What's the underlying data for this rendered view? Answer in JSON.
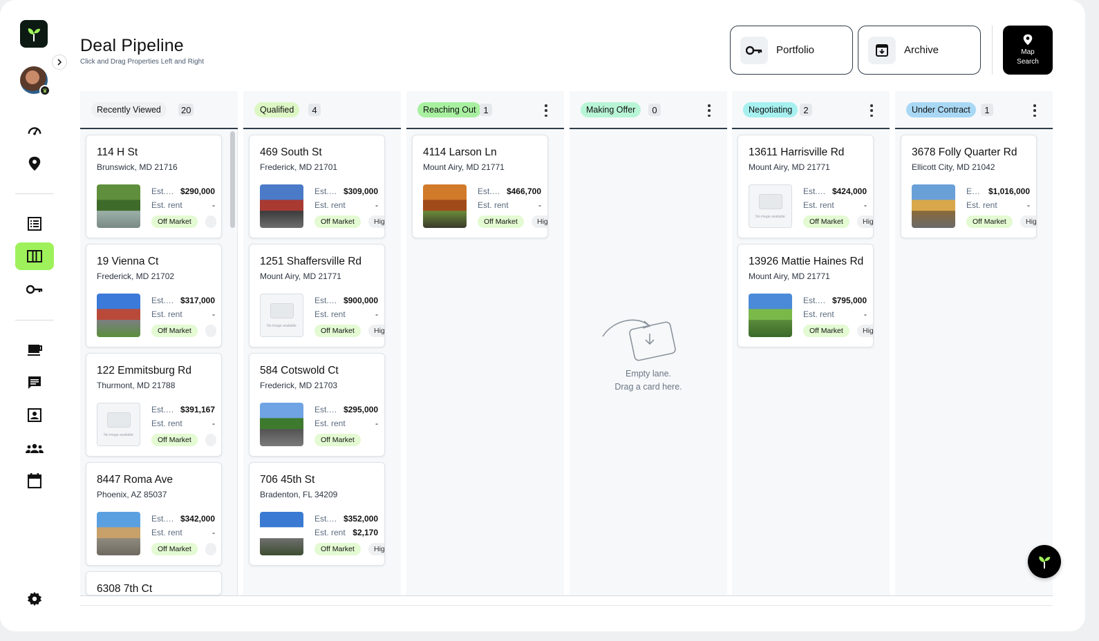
{
  "header": {
    "title": "Deal Pipeline",
    "subtitle": "Click and Drag Properties Left and Right",
    "portfolio_label": "Portfolio",
    "archive_label": "Archive",
    "map_search_label": "Map Search"
  },
  "sidebar": {
    "items": [
      "dashboard-icon",
      "location-icon",
      "list-icon",
      "kanban-icon",
      "key-icon",
      "inbox-icon",
      "chat-icon",
      "contact-icon",
      "team-icon",
      "calendar-icon",
      "settings-icon"
    ],
    "active": "kanban-icon"
  },
  "colors": {
    "accent": "#9ef15a",
    "recently_viewed": "#eef0f2",
    "qualified": "#ddf7c4",
    "reaching_out": "#a8f0a0",
    "making_offer": "#b8f5d6",
    "negotiating": "#a6f0f0",
    "under_contract": "#a9d8f5"
  },
  "lanes": [
    {
      "name": "Recently Viewed",
      "count": "20",
      "cards": [
        {
          "street": "114 H St",
          "city": "Brunswick, MD 21716",
          "est_label": "Est. Value",
          "value": "$290,000",
          "rent_label": "Est. rent",
          "rent": "-",
          "status": "Off Market",
          "tag": ""
        },
        {
          "street": "19 Vienna Ct",
          "city": "Frederick, MD 21702",
          "est_label": "Est. Value",
          "value": "$317,000",
          "rent_label": "Est. rent",
          "rent": "-",
          "status": "Off Market",
          "tag": ""
        },
        {
          "street": "122 Emmitsburg Rd",
          "city": "Thurmont, MD 21788",
          "est_label": "Est. Value",
          "value": "$391,167",
          "rent_label": "Est. rent",
          "rent": "-",
          "status": "Off Market",
          "tag": ""
        },
        {
          "street": "8447 Roma Ave",
          "city": "Phoenix, AZ 85037",
          "est_label": "Est. Value",
          "value": "$342,000",
          "rent_label": "Est. rent",
          "rent": "-",
          "status": "Off Market",
          "tag": ""
        },
        {
          "street": "6308 7th Ct",
          "city": "",
          "est_label": "",
          "value": "",
          "rent_label": "",
          "rent": "",
          "status": "",
          "tag": ""
        }
      ]
    },
    {
      "name": "Qualified",
      "count": "4",
      "cards": [
        {
          "street": "469 South St",
          "city": "Frederick, MD 21701",
          "est_label": "Est. Value",
          "value": "$309,000",
          "rent_label": "Est. rent",
          "rent": "-",
          "status": "Off Market",
          "tag": "Hig"
        },
        {
          "street": "1251 Shaffersville Rd",
          "city": "Mount Airy, MD 21771",
          "est_label": "Est. Value",
          "value": "$900,000",
          "rent_label": "Est. rent",
          "rent": "-",
          "status": "Off Market",
          "tag": "Hig"
        },
        {
          "street": "584 Cotswold Ct",
          "city": "Frederick, MD 21703",
          "est_label": "Est. Value",
          "value": "$295,000",
          "rent_label": "Est. rent",
          "rent": "-",
          "status": "Off Market",
          "tag": ""
        },
        {
          "street": "706 45th St",
          "city": "Bradenton, FL 34209",
          "est_label": "Est. Value",
          "value": "$352,000",
          "rent_label": "Est. rent",
          "rent": "$2,170",
          "status": "Off Market",
          "tag": "Hig"
        }
      ]
    },
    {
      "name": "Reaching Out",
      "count": "1",
      "cards": [
        {
          "street": "4114 Larson Ln",
          "city": "Mount Airy, MD 21771",
          "est_label": "Est. Value",
          "value": "$466,700",
          "rent_label": "Est. rent",
          "rent": "-",
          "status": "Off Market",
          "tag": "Hig"
        }
      ]
    },
    {
      "name": "Making Offer",
      "count": "0",
      "empty_line1": "Empty lane.",
      "empty_line2": "Drag a card here.",
      "cards": []
    },
    {
      "name": "Negotiating",
      "count": "2",
      "cards": [
        {
          "street": "13611 Harrisville Rd",
          "city": "Mount Airy, MD 21771",
          "est_label": "Est. Value",
          "value": "$424,000",
          "rent_label": "Est. rent",
          "rent": "-",
          "status": "Off Market",
          "tag": "Hig"
        },
        {
          "street": "13926 Mattie Haines Rd",
          "city": "Mount Airy, MD 21771",
          "est_label": "Est. Value",
          "value": "$795,000",
          "rent_label": "Est. rent",
          "rent": "-",
          "status": "Off Market",
          "tag": "Hig"
        }
      ]
    },
    {
      "name": "Under Contract",
      "count": "1",
      "cards": [
        {
          "street": "3678 Folly Quarter Rd",
          "city": "Ellicott City, MD 21042",
          "est_label": "Est. Value",
          "value": "$1,016,000",
          "rent_label": "Est. rent",
          "rent": "-",
          "status": "Off Market",
          "tag": "Hig"
        }
      ]
    }
  ]
}
